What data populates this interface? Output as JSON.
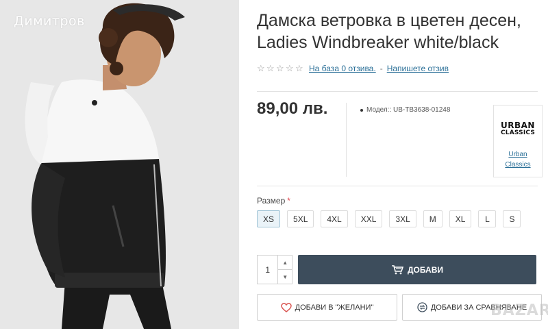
{
  "watermark": {
    "name": "Димитров",
    "corner_logo": "BAZAR"
  },
  "product": {
    "title_line1": "Дамска ветровка в цветен десен,",
    "title_line2": "Ladies Windbreaker white/black",
    "rating": {
      "stars": 0,
      "max_stars": 5,
      "reviews_link": "На база 0 отзива.",
      "separator": "-",
      "write_review": "Напишете отзив"
    },
    "price": "89,00 лв.",
    "model": "Модел:: UB-TB3638-01248",
    "brand": {
      "logo_line1": "URBAN",
      "logo_line2": "CLASSICS",
      "link_line1": "Urban",
      "link_line2": "Classics"
    }
  },
  "options": {
    "size_label": "Размер",
    "required_mark": "*",
    "sizes": [
      "XS",
      "5XL",
      "4XL",
      "XXL",
      "3XL",
      "M",
      "XL",
      "L",
      "S"
    ],
    "selected_size": "XS"
  },
  "cart": {
    "quantity": "1",
    "up_arrow": "▲",
    "down_arrow": "▼",
    "add_label": "ДОБАВИ",
    "wishlist_label": "ДОБАВИ В \"ЖЕЛАНИ\"",
    "compare_label": "ДОБАВИ ЗА СРАВНЯВАНЕ"
  },
  "colors": {
    "accent_button": "#3d4d5c",
    "link": "#2a6f97",
    "required": "#e0404a",
    "selected_size_bg": "#eaf3f8"
  },
  "icons": {
    "star": "star-outline-icon",
    "cart": "cart-icon",
    "heart": "heart-icon",
    "compare": "compare-icon"
  }
}
